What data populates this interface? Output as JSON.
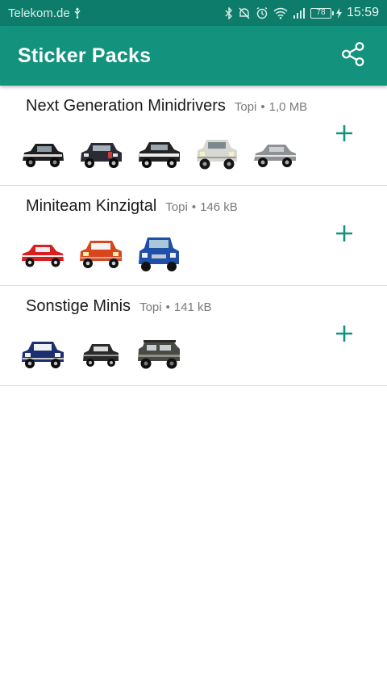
{
  "statusbar": {
    "carrier": "Telekom.de",
    "battery": "78",
    "time": "15:59"
  },
  "appbar": {
    "title": "Sticker Packs",
    "share_icon": "share-icon"
  },
  "colors": {
    "primary": "#13927d",
    "primary_dark": "#0e7c6b",
    "accent": "#13927d"
  },
  "packs": [
    {
      "name": "Next Generation Minidrivers",
      "author": "Topi",
      "size": "1,0 MB",
      "stickers": [
        "car-black",
        "car-checker",
        "car-black-white",
        "car-white",
        "car-silver"
      ]
    },
    {
      "name": "Miniteam Kinzigtal",
      "author": "Topi",
      "size": "146 kB",
      "stickers": [
        "car-red",
        "car-orange",
        "car-blue"
      ]
    },
    {
      "name": "Sonstige Minis",
      "author": "Topi",
      "size": "141 kB",
      "stickers": [
        "car-navy",
        "car-dark-small",
        "car-offroad"
      ]
    }
  ]
}
